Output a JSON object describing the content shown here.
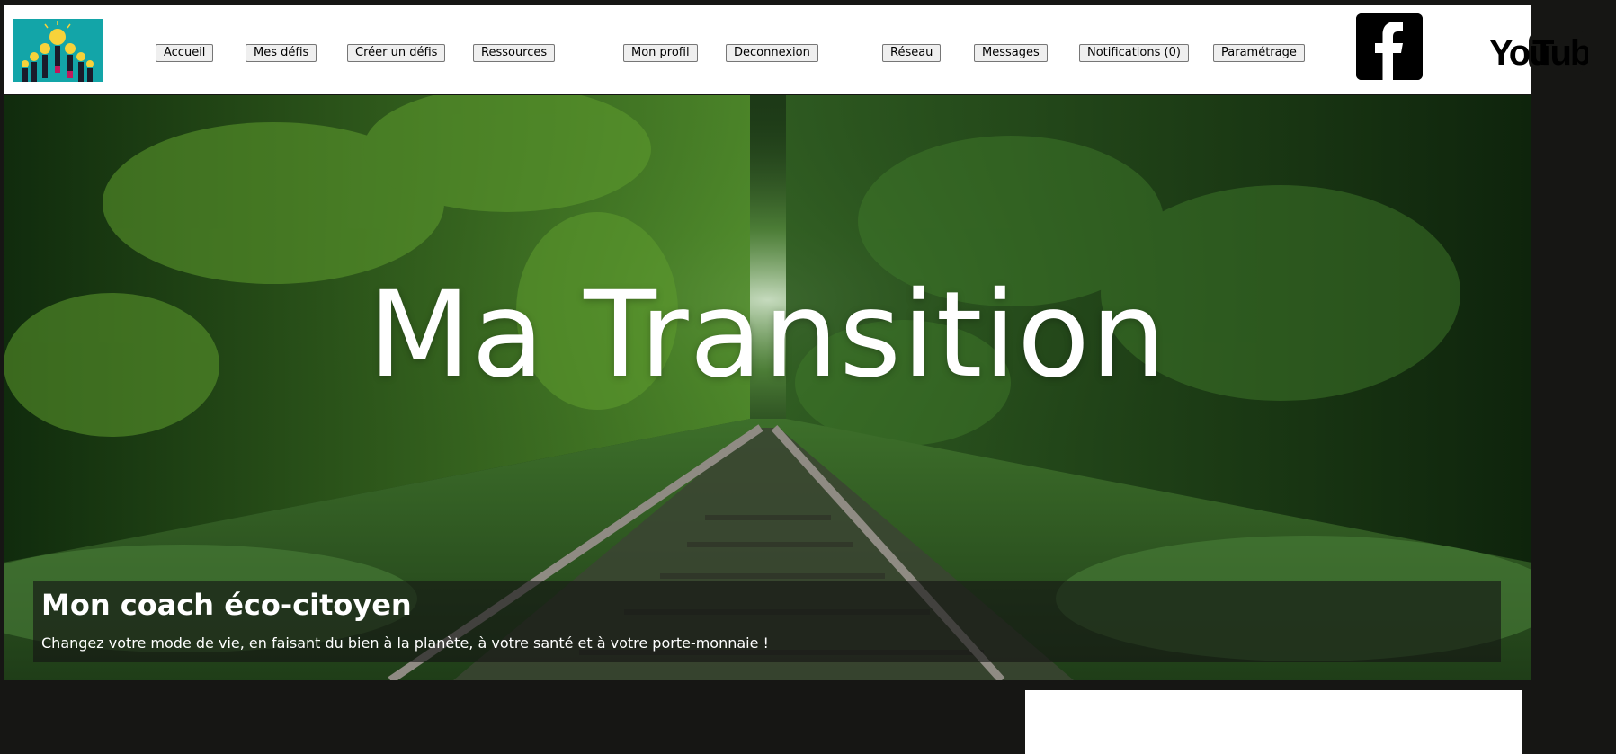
{
  "nav": {
    "accueil": "Accueil",
    "mes_defis": "Mes défis",
    "creer_defis": "Créer un défis",
    "ressources": "Ressources",
    "mon_profil": "Mon profil",
    "deconnexion": "Deconnexion",
    "reseau": "Réseau",
    "messages": "Messages",
    "notifications": "Notifications (0)",
    "parametrage": "Paramétrage"
  },
  "social": {
    "facebook_icon": "facebook-icon",
    "youtube_icon": "youtube-icon",
    "youtube_text_you": "You",
    "youtube_text_tube": "Tube"
  },
  "hero": {
    "title": "Ma Transition",
    "caption_title": "Mon coach éco-citoyen",
    "caption_text": "Changez votre mode de vie, en faisant du bien à la planète, à votre santé et à votre porte-monnaie !"
  },
  "colors": {
    "page_bg": "#161614",
    "topbar_bg": "#ffffff",
    "logo_bg": "#13a5a8",
    "caption_bg": "rgba(20,20,20,0.62)"
  }
}
